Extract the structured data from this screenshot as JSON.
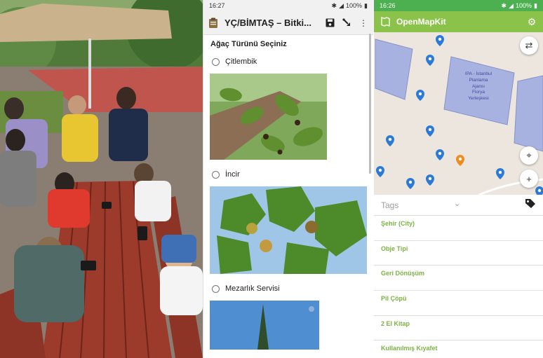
{
  "odk": {
    "status": {
      "time": "16:27",
      "battery": "100%"
    },
    "title": "YÇ/BİMTAŞ – Bitki...",
    "question": "Ağaç Türünü Seçiniz",
    "options": [
      {
        "label": "Çitlembik"
      },
      {
        "label": "İncir"
      },
      {
        "label": "Mezarlık Servisi"
      }
    ],
    "icons": {
      "form": "clipboard-icon",
      "save": "save-icon",
      "nav": "jump-icon",
      "menu": "more-vert-icon"
    }
  },
  "omk": {
    "status": {
      "time": "16:26",
      "battery": "100%"
    },
    "title": "OpenMapKit",
    "building_label": "IPA - İstanbul\nPlanlama\nAjansı\nFlorya\nYerleşkesi",
    "tags_label": "Tags",
    "tags": [
      "Şehir (City)",
      "Obje Tipi",
      "Geri Dönüşüm",
      "Pil Çöpü",
      "2 El Kitap",
      "Kullanılmış Kıyafet"
    ],
    "colors": {
      "status": "#4caf50",
      "toolbar": "#8bc34a",
      "tag_text": "#7cb342",
      "pin_blue": "#2b7bd6",
      "pin_orange": "#f08c1e"
    }
  },
  "photo": {
    "description_icon": "photo"
  }
}
